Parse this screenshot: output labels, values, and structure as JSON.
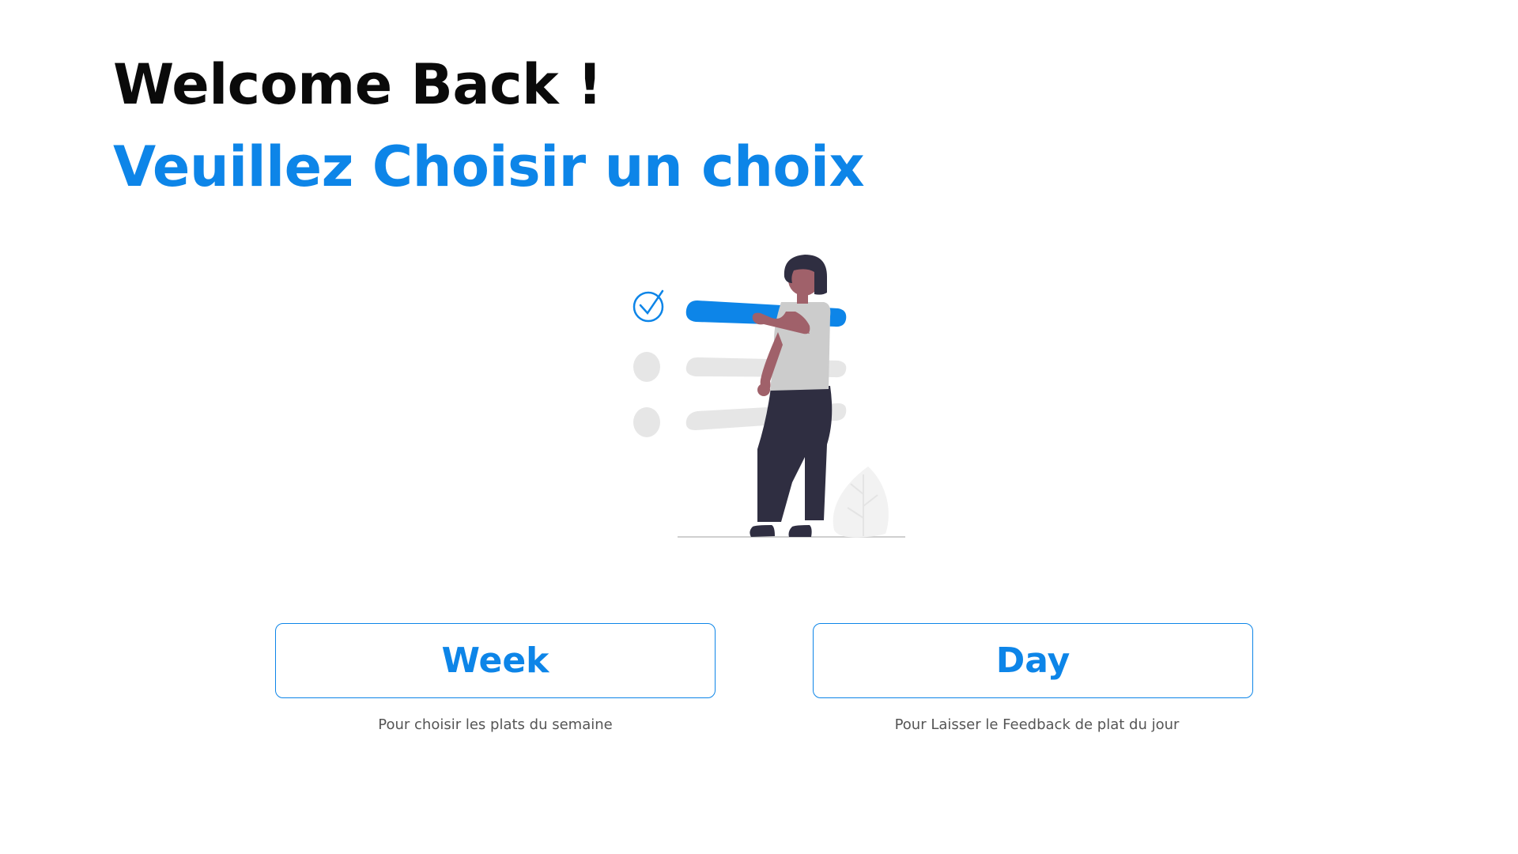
{
  "header": {
    "title": "Welcome Back !",
    "subtitle": "Veuillez Choisir un choix"
  },
  "illustration": {
    "icon": "checklist-person-illustration",
    "colors": {
      "accent": "#0d85e8",
      "placeholder": "#e6e6e6",
      "shirt": "#cccccc",
      "pants": "#2f2e41",
      "skin": "#a0616a",
      "hair": "#2f2e41",
      "plant": "#f2f2f2"
    }
  },
  "choices": [
    {
      "label": "Week",
      "caption": "Pour choisir les plats du semaine"
    },
    {
      "label": "Day",
      "caption": "Pour Laisser le Feedback de plat du jour"
    }
  ],
  "colors": {
    "primary": "#0d85e8",
    "heading": "#0a0a0a",
    "caption": "#555555",
    "background": "#ffffff"
  }
}
